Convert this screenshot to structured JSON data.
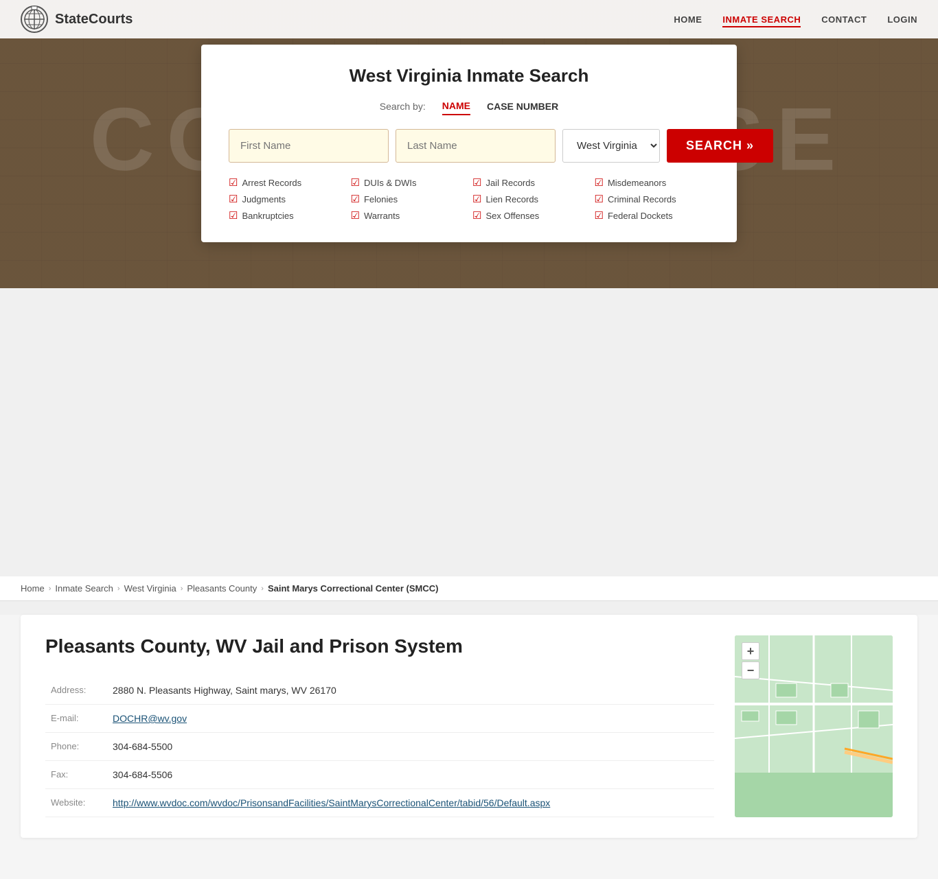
{
  "site": {
    "name": "StateCourts"
  },
  "nav": {
    "links": [
      {
        "label": "HOME",
        "href": "#",
        "active": false
      },
      {
        "label": "INMATE SEARCH",
        "href": "#",
        "active": true
      },
      {
        "label": "CONTACT",
        "href": "#",
        "active": false
      },
      {
        "label": "LOGIN",
        "href": "#",
        "active": false
      }
    ]
  },
  "hero_letters": "COURTHOUSE",
  "search_card": {
    "title": "West Virginia Inmate Search",
    "search_by_label": "Search by:",
    "tab_name": "NAME",
    "tab_case": "CASE NUMBER",
    "first_name_placeholder": "First Name",
    "last_name_placeholder": "Last Name",
    "state_value": "West Virginia",
    "search_button": "SEARCH »",
    "checkboxes": [
      {
        "label": "Arrest Records"
      },
      {
        "label": "DUIs & DWIs"
      },
      {
        "label": "Jail Records"
      },
      {
        "label": "Misdemeanors"
      },
      {
        "label": "Judgments"
      },
      {
        "label": "Felonies"
      },
      {
        "label": "Lien Records"
      },
      {
        "label": "Criminal Records"
      },
      {
        "label": "Bankruptcies"
      },
      {
        "label": "Warrants"
      },
      {
        "label": "Sex Offenses"
      },
      {
        "label": "Federal Dockets"
      }
    ]
  },
  "breadcrumb": {
    "items": [
      {
        "label": "Home",
        "href": "#"
      },
      {
        "label": "Inmate Search",
        "href": "#"
      },
      {
        "label": "West Virginia",
        "href": "#"
      },
      {
        "label": "Pleasants County",
        "href": "#"
      },
      {
        "label": "Saint Marys Correctional Center (SMCC)",
        "current": true
      }
    ]
  },
  "facility": {
    "title": "Pleasants County, WV Jail and Prison System",
    "fields": [
      {
        "label": "Address:",
        "value": "2880 N. Pleasants Highway, Saint marys, WV 26170",
        "link": false
      },
      {
        "label": "E-mail:",
        "value": "DOCHR@wv.gov",
        "link": true,
        "href": "mailto:DOCHR@wv.gov"
      },
      {
        "label": "Phone:",
        "value": "304-684-5500",
        "link": false
      },
      {
        "label": "Fax:",
        "value": "304-684-5506",
        "link": false
      },
      {
        "label": "Website:",
        "value": "http://www.wvdoc.com/wvdoc/PrisonsandFacilities/SaintMarysCorrectionalCenter/tabid/56/Default.aspx",
        "link": true,
        "href": "http://www.wvdoc.com/wvdoc/PrisonsandFacilities/SaintMarysCorrectionalCenter/tabid/56/Default.aspx"
      }
    ]
  },
  "map": {
    "zoom_in": "+",
    "zoom_out": "−"
  }
}
